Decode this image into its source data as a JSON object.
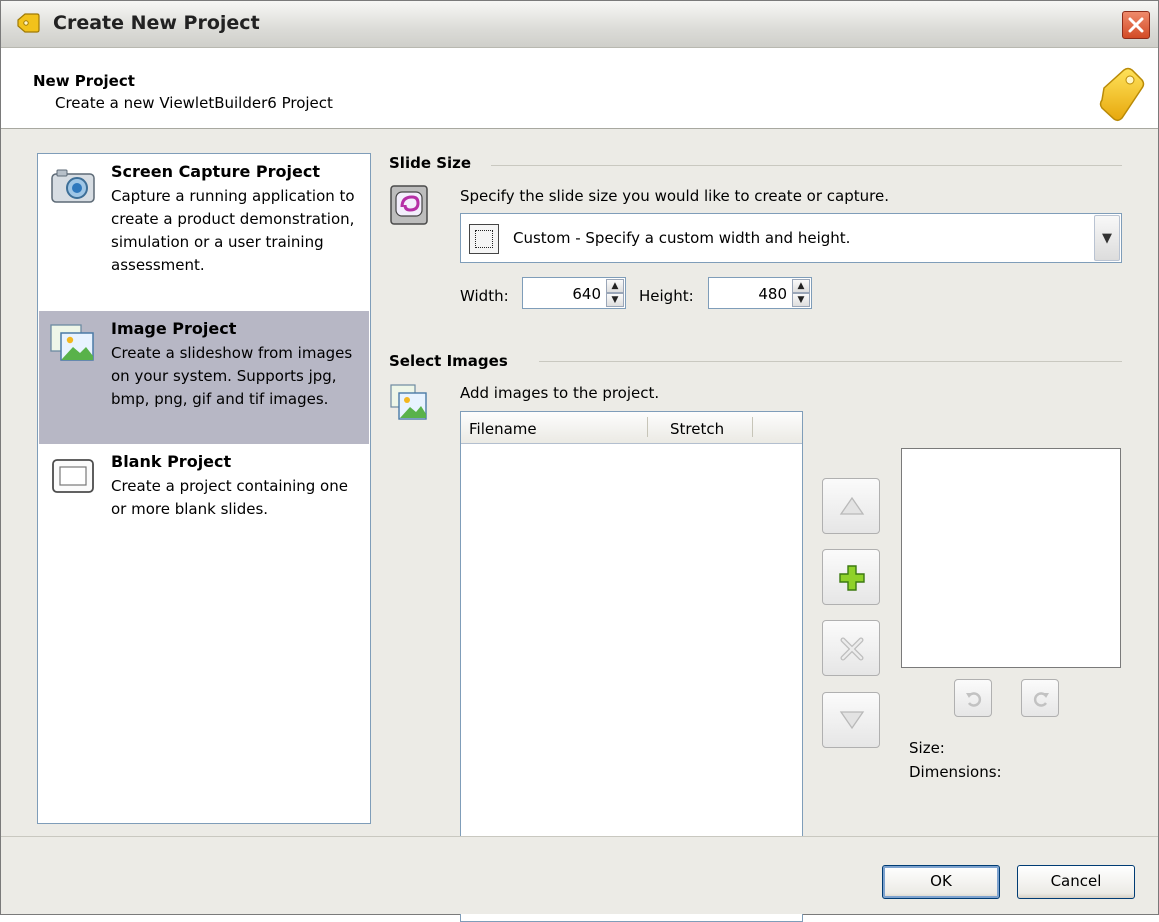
{
  "window": {
    "title": "Create New Project"
  },
  "header": {
    "title": "New Project",
    "subtitle": "Create a new ViewletBuilder6 Project"
  },
  "project_types": [
    {
      "title": "Screen Capture Project",
      "description": "Capture a running application to create a product demonstration, simulation or a user training assessment.",
      "icon": "camera-icon",
      "selected": false
    },
    {
      "title": "Image Project",
      "description": "Create a slideshow from images on your system. Supports jpg, bmp, png, gif and tif images.",
      "icon": "images-icon",
      "selected": true
    },
    {
      "title": "Blank Project",
      "description": "Create a project containing one or more blank slides.",
      "icon": "blank-slide-icon",
      "selected": false
    }
  ],
  "slide_size": {
    "label": "Slide Size",
    "instruction": "Specify the slide size you would like to create or capture.",
    "selected_option": "Custom - Specify a custom width and height.",
    "width_label": "Width:",
    "width_value": "640",
    "height_label": "Height:",
    "height_value": "480"
  },
  "select_images": {
    "label": "Select Images",
    "instruction": "Add images to the project.",
    "columns": [
      "Filename",
      "Stretch"
    ],
    "rows": []
  },
  "image_info": {
    "size_label": "Size:",
    "dimensions_label": "Dimensions:"
  },
  "footer": {
    "ok_label": "OK",
    "cancel_label": "Cancel"
  },
  "colors": {
    "selected_row": "#b7b7c5",
    "close_button": "#d24b26",
    "add_icon": "#8fd12a"
  }
}
